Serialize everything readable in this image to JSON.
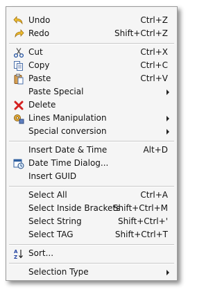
{
  "menu": {
    "undo": {
      "label": "Undo",
      "shortcut": "Ctrl+Z"
    },
    "redo": {
      "label": "Redo",
      "shortcut": "Shift+Ctrl+Z"
    },
    "cut": {
      "label": "Cut",
      "shortcut": "Ctrl+X"
    },
    "copy": {
      "label": "Copy",
      "shortcut": "Ctrl+C"
    },
    "paste": {
      "label": "Paste",
      "shortcut": "Ctrl+V"
    },
    "paste_special": {
      "label": "Paste Special"
    },
    "delete": {
      "label": "Delete"
    },
    "lines_manipulation": {
      "label": "Lines Manipulation"
    },
    "special_conversion": {
      "label": "Special conversion"
    },
    "insert_date_time": {
      "label": "Insert Date & Time",
      "shortcut": "Alt+D"
    },
    "date_time_dialog": {
      "label": "Date Time Dialog..."
    },
    "insert_guid": {
      "label": "Insert GUID"
    },
    "select_all": {
      "label": "Select All",
      "shortcut": "Ctrl+A"
    },
    "select_inside_brackets": {
      "label": "Select Inside Brackets",
      "shortcut": "Shift+Ctrl+M"
    },
    "select_string": {
      "label": "Select String",
      "shortcut": "Shift+Ctrl+'"
    },
    "select_tag": {
      "label": "Select TAG",
      "shortcut": "Shift+Ctrl+T"
    },
    "sort": {
      "label": "Sort..."
    },
    "selection_type": {
      "label": "Selection Type"
    }
  },
  "icons": {
    "undo": "undo-arrow-icon",
    "redo": "redo-arrow-icon",
    "cut": "scissors-icon",
    "copy": "copy-document-icon",
    "paste": "clipboard-icon",
    "delete": "red-x-icon",
    "lines_manipulation": "gear-lines-icon",
    "date_time_dialog": "calendar-clock-icon",
    "sort": "sort-az-icon"
  },
  "colors": {
    "menu_background": "#f5f5f5",
    "separator": "#c8c8c8",
    "undo_redo_arrow": "#e8b020",
    "delete_x": "#d42020"
  }
}
